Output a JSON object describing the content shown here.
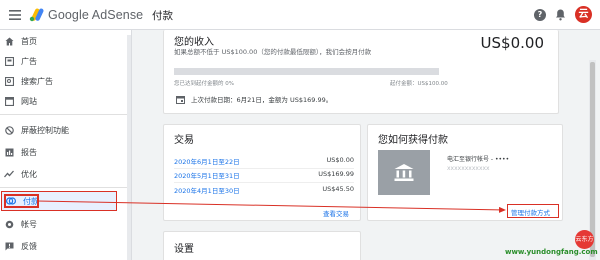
{
  "header": {
    "app_name": "Google AdSense",
    "page_title": "付款",
    "help_icon": "?",
    "notifications_icon": "bell-icon",
    "avatar_letter": "云",
    "avatar_color": "#d93025"
  },
  "sidebar": {
    "items": [
      {
        "label": "首页",
        "icon": "home-icon"
      },
      {
        "label": "广告",
        "icon": "ads-icon"
      },
      {
        "label": "搜索广告",
        "icon": "search-ads-icon"
      },
      {
        "label": "网站",
        "icon": "sites-icon"
      },
      {
        "label": "屏蔽控制功能",
        "icon": "block-icon"
      },
      {
        "label": "报告",
        "icon": "reports-icon"
      },
      {
        "label": "优化",
        "icon": "optimize-icon"
      },
      {
        "label": "付款",
        "icon": "payments-icon",
        "active": true
      },
      {
        "label": "帐号",
        "icon": "account-icon"
      },
      {
        "label": "反馈",
        "icon": "feedback-icon"
      }
    ]
  },
  "income": {
    "title": "您的收入",
    "subtitle": "如果总额不低于 US$100.00（您的付款最低限额），我们会按月付款",
    "amount": "US$0.00",
    "progress_percent": 0,
    "progress_left": "您已达到起付金额的 0%",
    "progress_right": "起付金额：US$100.00",
    "last_payment": "上次付款日期：6月21日，金额为 US$169.99。"
  },
  "transactions": {
    "title": "交易",
    "rows": [
      {
        "date": "2020年6月1日至22日",
        "amount": "US$0.00"
      },
      {
        "date": "2020年5月1日至31日",
        "amount": "US$169.99"
      },
      {
        "date": "2020年4月1日至30日",
        "amount": "US$45.50"
      }
    ],
    "view_link": "查看交易"
  },
  "how_paid": {
    "title": "您如何获得付款",
    "account_label": "电汇至银行帐号 - ••••",
    "account_name": "xxxxxxxxxxxx",
    "manage_link": "管理付款方式",
    "bank_icon": "bank-icon"
  },
  "settings": {
    "title": "设置"
  },
  "watermark": {
    "text": "www.yundongfang.com",
    "badge": "云东方"
  },
  "colors": {
    "accent": "#1a73e8",
    "highlight": "#d93025"
  }
}
